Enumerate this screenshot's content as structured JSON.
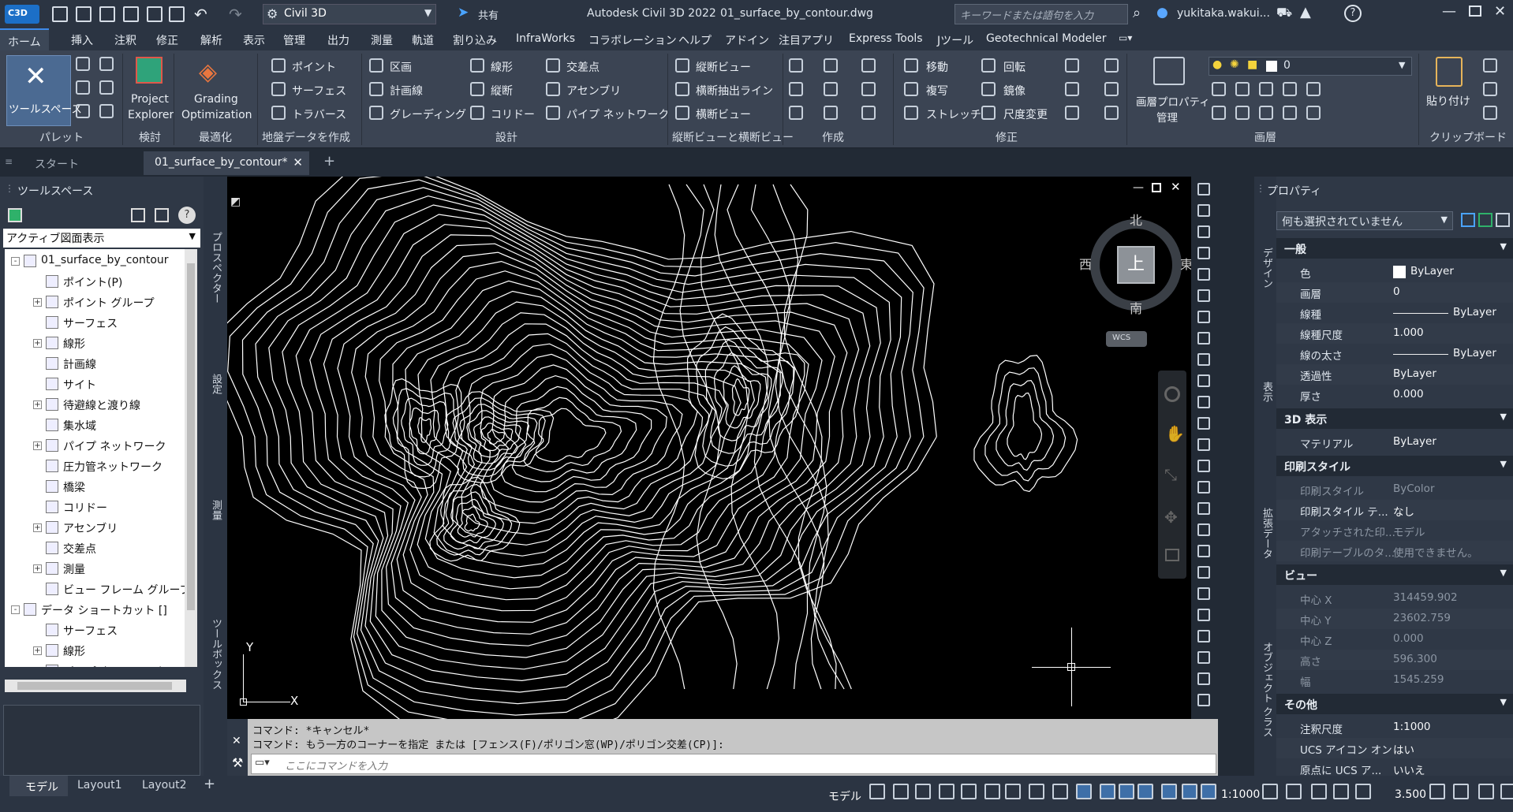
{
  "title_bar": {
    "app_badge": "C3D",
    "workspace": "Civil 3D",
    "share": "共有",
    "app_title": "Autodesk Civil 3D 2022",
    "doc_name": "01_surface_by_contour.dwg",
    "search_placeholder": "キーワードまたは語句を入力",
    "user": "yukitaka.wakui..."
  },
  "menu": [
    "ホーム",
    "挿入",
    "注釈",
    "修正",
    "解析",
    "表示",
    "管理",
    "出力",
    "測量",
    "軌道",
    "割り込み",
    "InfraWorks",
    "コラボレーション",
    "ヘルプ",
    "アドイン",
    "注目アプリ",
    "Express Tools",
    "Jツール",
    "Geotechnical Modeler"
  ],
  "ribbon": {
    "toolspace": "ツールスペース",
    "palette": "パレット",
    "project_explorer_1": "Project",
    "project_explorer_2": "Explorer",
    "check": "検討",
    "grading_1": "Grading",
    "grading_2": "Optimization",
    "optimize": "最適化",
    "points": "ポイント",
    "surfaces": "サーフェス",
    "traverse": "トラバース",
    "create_ground": "地盤データを作成",
    "parcel": "区画",
    "feature_line": "計画線",
    "grading": "グレーディング",
    "alignment": "線形",
    "profile": "縦断",
    "corridor": "コリドー",
    "intersection": "交差点",
    "assembly": "アセンブリ",
    "pipe_network": "パイプ ネットワーク",
    "design": "設計",
    "profile_view": "縦断ビュー",
    "sample_lines": "横断抽出ライン",
    "section_view": "横断ビュー",
    "profile_section": "縦断ビューと横断ビュー",
    "draw": "作成",
    "move": "移動",
    "rotate": "回転",
    "copy": "複写",
    "mirror": "鏡像",
    "stretch": "ストレッチ",
    "scale": "尺度変更",
    "modify": "修正",
    "layer_props_1": "画層プロパティ",
    "layer_props_2": "管理",
    "layer_value": "0",
    "layers": "画層",
    "paste": "貼り付け",
    "clipboard": "クリップボード"
  },
  "tabs": {
    "start": "スタート",
    "drawing": "01_surface_by_contour*"
  },
  "toolspace": {
    "title": "ツールスペース",
    "view": "アクティブ図面表示",
    "side_tabs": [
      "プロスペクター",
      "設定",
      "測量",
      "ツールボックス"
    ],
    "tree": [
      {
        "label": "01_surface_by_contour",
        "level": 0,
        "exp": "-"
      },
      {
        "label": "ポイント(P)",
        "level": 1,
        "exp": ""
      },
      {
        "label": "ポイント グループ",
        "level": 1,
        "exp": "+"
      },
      {
        "label": "サーフェス",
        "level": 1,
        "exp": ""
      },
      {
        "label": "線形",
        "level": 1,
        "exp": "+"
      },
      {
        "label": "計画線",
        "level": 1,
        "exp": ""
      },
      {
        "label": "サイト",
        "level": 1,
        "exp": ""
      },
      {
        "label": "待避線と渡り線",
        "level": 1,
        "exp": "+"
      },
      {
        "label": "集水域",
        "level": 1,
        "exp": ""
      },
      {
        "label": "パイプ ネットワーク",
        "level": 1,
        "exp": "+"
      },
      {
        "label": "圧力管ネットワーク",
        "level": 1,
        "exp": ""
      },
      {
        "label": "橋梁",
        "level": 1,
        "exp": ""
      },
      {
        "label": "コリドー",
        "level": 1,
        "exp": ""
      },
      {
        "label": "アセンブリ",
        "level": 1,
        "exp": "+"
      },
      {
        "label": "交差点",
        "level": 1,
        "exp": ""
      },
      {
        "label": "測量",
        "level": 1,
        "exp": "+"
      },
      {
        "label": "ビュー フレーム グループ",
        "level": 1,
        "exp": ""
      },
      {
        "label": "データ ショートカット []",
        "level": 0,
        "exp": "-"
      },
      {
        "label": "サーフェス",
        "level": 1,
        "exp": ""
      },
      {
        "label": "線形",
        "level": 1,
        "exp": "+"
      },
      {
        "label": "パイプ ネットワーク",
        "level": 1,
        "exp": ""
      }
    ]
  },
  "viewcube": {
    "north": "北",
    "south": "南",
    "east": "東",
    "west": "西",
    "top": "上",
    "wcs": "WCS"
  },
  "axis": {
    "y": "Y",
    "x": "X"
  },
  "command": {
    "line1": "コマンド:  *キャンセル*",
    "line2": "コマンド:  もう一方のコーナーを指定 または [フェンス(F)/ポリゴン窓(WP)/ポリゴン交差(CP)]:",
    "placeholder": "ここにコマンドを入力"
  },
  "properties": {
    "title": "プロパティ",
    "selection": "何も選択されていません",
    "side_tabs": [
      "デザイン",
      "表示",
      "拡張データ",
      "オブジェクト クラス"
    ],
    "sections": [
      {
        "name": "一般",
        "rows": [
          {
            "k": "色",
            "v": "ByLayer",
            "swatch": true
          },
          {
            "k": "画層",
            "v": "0"
          },
          {
            "k": "線種",
            "v": "ByLayer",
            "line": true
          },
          {
            "k": "線種尺度",
            "v": "1.000"
          },
          {
            "k": "線の太さ",
            "v": "ByLayer",
            "line": true
          },
          {
            "k": "透過性",
            "v": "ByLayer"
          },
          {
            "k": "厚さ",
            "v": "0.000"
          }
        ]
      },
      {
        "name": "3D 表示",
        "rows": [
          {
            "k": "マテリアル",
            "v": "ByLayer"
          }
        ]
      },
      {
        "name": "印刷スタイル",
        "rows": [
          {
            "k": "印刷スタイル",
            "v": "ByColor",
            "dim": true
          },
          {
            "k": "印刷スタイル テ...",
            "v": "なし"
          },
          {
            "k": "アタッチされた印...",
            "v": "モデル",
            "dim": true
          },
          {
            "k": "印刷テーブルのタ...",
            "v": "使用できません。",
            "dim": true
          }
        ]
      },
      {
        "name": "ビュー",
        "rows": [
          {
            "k": "中心 X",
            "v": "314459.902",
            "dim": true
          },
          {
            "k": "中心 Y",
            "v": "23602.759",
            "dim": true
          },
          {
            "k": "中心 Z",
            "v": "0.000",
            "dim": true
          },
          {
            "k": "高さ",
            "v": "596.300",
            "dim": true
          },
          {
            "k": "幅",
            "v": "1545.259",
            "dim": true
          }
        ]
      },
      {
        "name": "その他",
        "rows": [
          {
            "k": "注釈尺度",
            "v": "1:1000"
          },
          {
            "k": "UCS アイコン オン",
            "v": "はい"
          },
          {
            "k": "原点に UCS ア...",
            "v": "いいえ"
          }
        ]
      }
    ]
  },
  "status": {
    "model_tab": "モデル",
    "layout1": "Layout1",
    "layout2": "Layout2",
    "model_label": "モデル",
    "scale": "1:1000",
    "value": "3.500"
  },
  "colors": {
    "accent": "#3e8ae8",
    "background": "#222a35",
    "ribbon": "#3b4453"
  }
}
